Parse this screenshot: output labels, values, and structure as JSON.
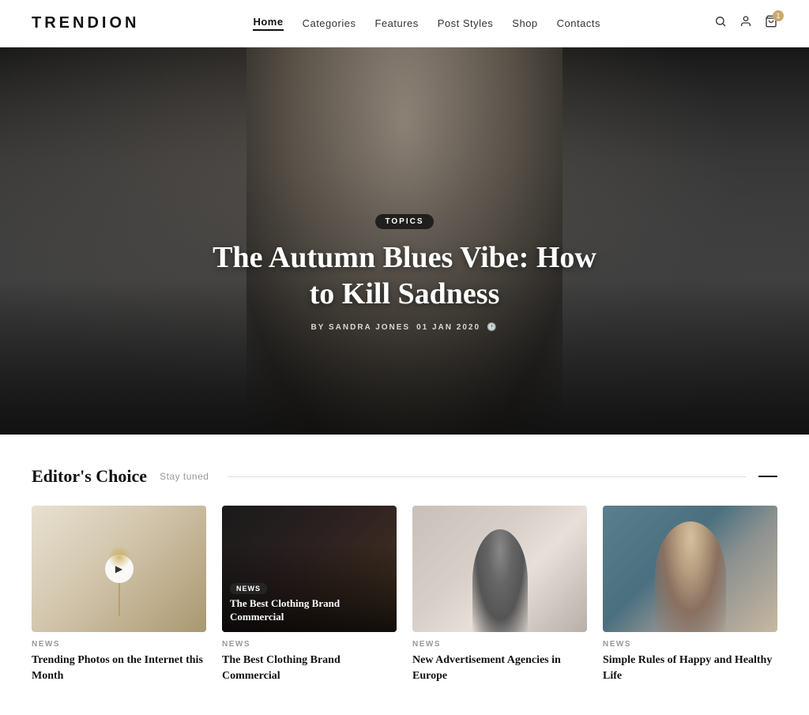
{
  "header": {
    "logo": "TRENDION",
    "nav": {
      "items": [
        {
          "label": "Home",
          "active": true
        },
        {
          "label": "Categories",
          "active": false
        },
        {
          "label": "Features",
          "active": false
        },
        {
          "label": "Post Styles",
          "active": false
        },
        {
          "label": "Shop",
          "active": false
        },
        {
          "label": "Contacts",
          "active": false
        }
      ]
    },
    "cart_count": "1"
  },
  "hero": {
    "tag": "TOPICS",
    "title": "The Autumn Blues Vibe: How to Kill Sadness",
    "author_label": "BY SANDRA JONES",
    "date": "01 JAN 2020",
    "icon": "🕐"
  },
  "editors_choice": {
    "title": "Editor's Choice",
    "subtitle": "Stay tuned",
    "cards": [
      {
        "category": "NEWS",
        "title": "Trending Photos on the Internet this Month",
        "has_play": true
      },
      {
        "category": "NEWS",
        "title": "The Best Clothing Brand Commercial",
        "has_overlay_title": true
      },
      {
        "category": "NEWS",
        "title": "New Advertisement Agencies in Europe"
      },
      {
        "category": "NEWS",
        "title": "Simple Rules of Happy and Healthy Life"
      }
    ]
  }
}
